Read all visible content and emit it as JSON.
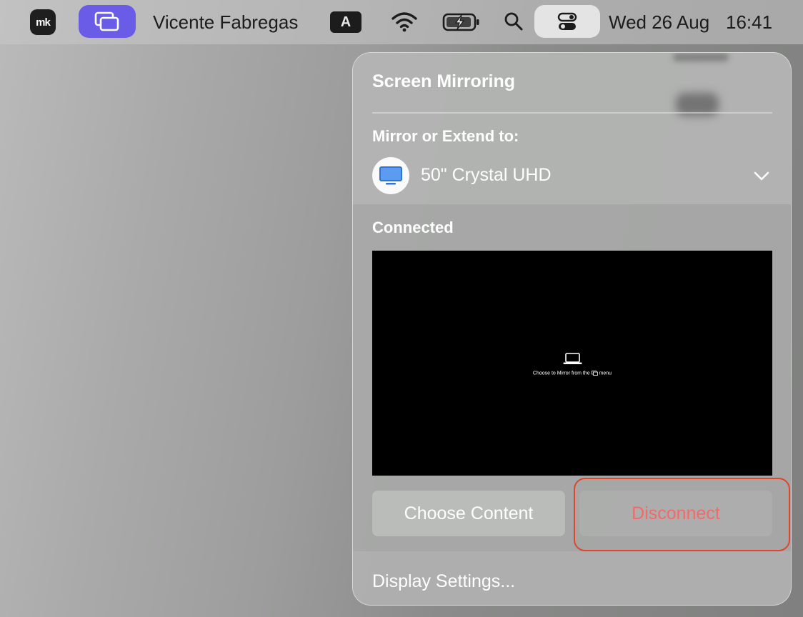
{
  "menubar": {
    "logo_text": "mk",
    "logo_icon": "mk-logo-icon",
    "mirror_icon": "screen-mirroring-icon",
    "user_name": "Vicente Fabregas",
    "input_source": "A",
    "wifi_icon": "wifi-icon",
    "battery_icon": "battery-charging-icon",
    "search_icon": "search-icon",
    "control_center_icon": "control-center-icon",
    "date": "Wed 26 Aug",
    "time": "16:41",
    "accent_color": "#6a5ce6"
  },
  "panel": {
    "title": "Screen Mirroring",
    "mirror_label": "Mirror or Extend to:",
    "device_name": "50\" Crystal UHD",
    "device_icon": "display-icon",
    "connected_label": "Connected",
    "preview_caption_before": "Choose to Mirror from the",
    "preview_caption_after": "menu",
    "choose_content": "Choose Content",
    "disconnect": "Disconnect",
    "display_settings": "Display Settings...",
    "disconnect_color": "#f26b6b",
    "highlight_color": "#e0452d"
  }
}
